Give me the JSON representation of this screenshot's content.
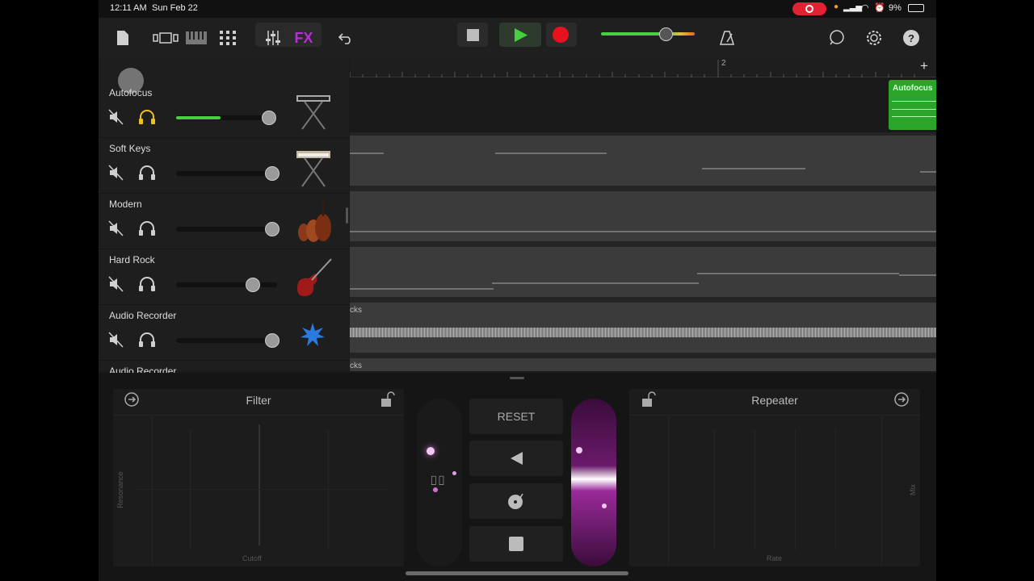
{
  "status_bar": {
    "time": "12:11 AM",
    "date": "Sun Feb 22",
    "battery": "9%"
  },
  "toolbar": {
    "fx_label": "FX"
  },
  "ruler": {
    "bar_marker": "2"
  },
  "tracks": [
    {
      "name": "Autofocus",
      "volume": 0.45,
      "solo_active": true
    },
    {
      "name": "Soft Keys",
      "volume": 1.0,
      "solo_active": false
    },
    {
      "name": "Modern",
      "volume": 1.0,
      "solo_active": false
    },
    {
      "name": "Hard Rock",
      "volume": 0.8,
      "solo_active": false
    },
    {
      "name": "Audio Recorder",
      "volume": 1.0,
      "solo_active": false
    },
    {
      "name": "Audio Recorder",
      "volume": 1.0,
      "solo_active": false
    }
  ],
  "regions": {
    "autofocus_region": "Autofocus",
    "audio_region_label": "cks",
    "audio_region_label_2": "cks"
  },
  "fx": {
    "filter": {
      "title": "Filter",
      "x_axis": "Cutoff",
      "y_axis": "Resonance"
    },
    "repeater": {
      "title": "Repeater",
      "x_axis": "Rate",
      "y_axis": "Mix"
    },
    "reset_label": "RESET"
  },
  "colors": {
    "accent_green": "#45d13f",
    "fx_purple": "#b32fd6",
    "record_red": "#e8121e"
  }
}
